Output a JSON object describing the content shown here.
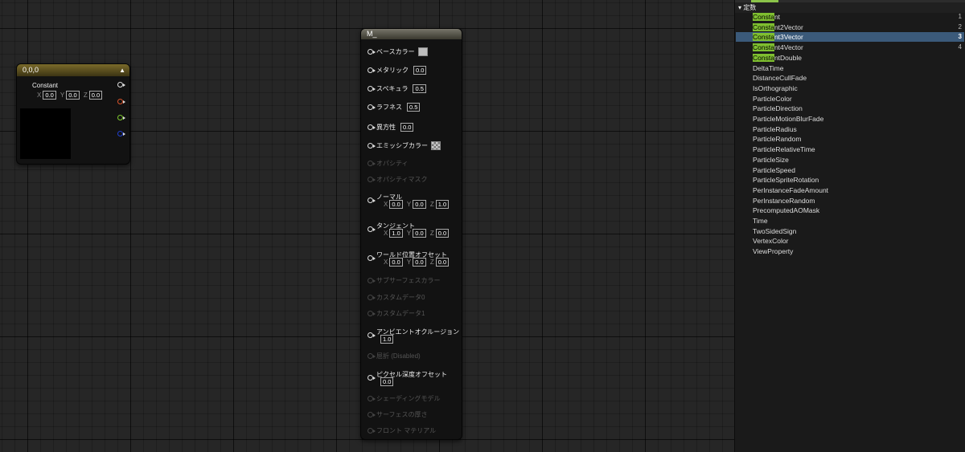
{
  "constant_node": {
    "title": "0,0,0",
    "label": "Constant",
    "x_label": "X",
    "x_value": "0.0",
    "y_label": "Y",
    "y_value": "0.0",
    "z_label": "Z",
    "z_value": "0.0"
  },
  "material_node": {
    "title": "M_",
    "inputs": [
      {
        "label": "ベースカラー"
      },
      {
        "label": "メタリック",
        "value": "0.0"
      },
      {
        "label": "スペキュラ",
        "value": "0.5"
      },
      {
        "label": "ラフネス",
        "value": "0.5"
      },
      {
        "label": "異方性",
        "value": "0.0"
      },
      {
        "label": "エミッシブカラー"
      },
      {
        "label": "オパシティ"
      },
      {
        "label": "オパシティマスク"
      },
      {
        "label": "ノーマル",
        "x": "0.0",
        "y": "0.0",
        "z": "1.0"
      },
      {
        "label": "タンジェント",
        "x": "1.0",
        "y": "0.0",
        "z": "0.0"
      },
      {
        "label": "ワールド位置オフセット",
        "x": "0.0",
        "y": "0.0",
        "z": "0.0"
      },
      {
        "label": "サブサーフェスカラー"
      },
      {
        "label": "カスタムデータ0"
      },
      {
        "label": "カスタムデータ1"
      },
      {
        "label": "アンビエントオクルージョン",
        "value": "1.0"
      },
      {
        "label": "屈折 (Disabled)"
      },
      {
        "label": "ピクセル深度オフセット",
        "value": "0.0"
      },
      {
        "label": "シェーディングモデル"
      },
      {
        "label": "サーフェスの厚さ"
      },
      {
        "label": "フロント マテリアル"
      }
    ],
    "axis": {
      "x": "X",
      "y": "Y",
      "z": "Z"
    }
  },
  "palette": {
    "section_title": "定数",
    "search_highlight": "Consta",
    "items": [
      {
        "rest": "nt",
        "shortcut": "1"
      },
      {
        "rest": "nt2Vector",
        "shortcut": "2"
      },
      {
        "rest": "nt3Vector",
        "shortcut": "3"
      },
      {
        "rest": "nt4Vector",
        "shortcut": "4"
      },
      {
        "rest": "ntDouble",
        "shortcut": ""
      }
    ],
    "others": [
      "DeltaTime",
      "DistanceCullFade",
      "IsOrthographic",
      "ParticleColor",
      "ParticleDirection",
      "ParticleMotionBlurFade",
      "ParticleRadius",
      "ParticleRandom",
      "ParticleRelativeTime",
      "ParticleSize",
      "ParticleSpeed",
      "ParticleSpriteRotation",
      "PerInstanceFadeAmount",
      "PerInstanceRandom",
      "PrecomputedAOMask",
      "Time",
      "TwoSidedSign",
      "VertexColor",
      "ViewProperty"
    ]
  }
}
